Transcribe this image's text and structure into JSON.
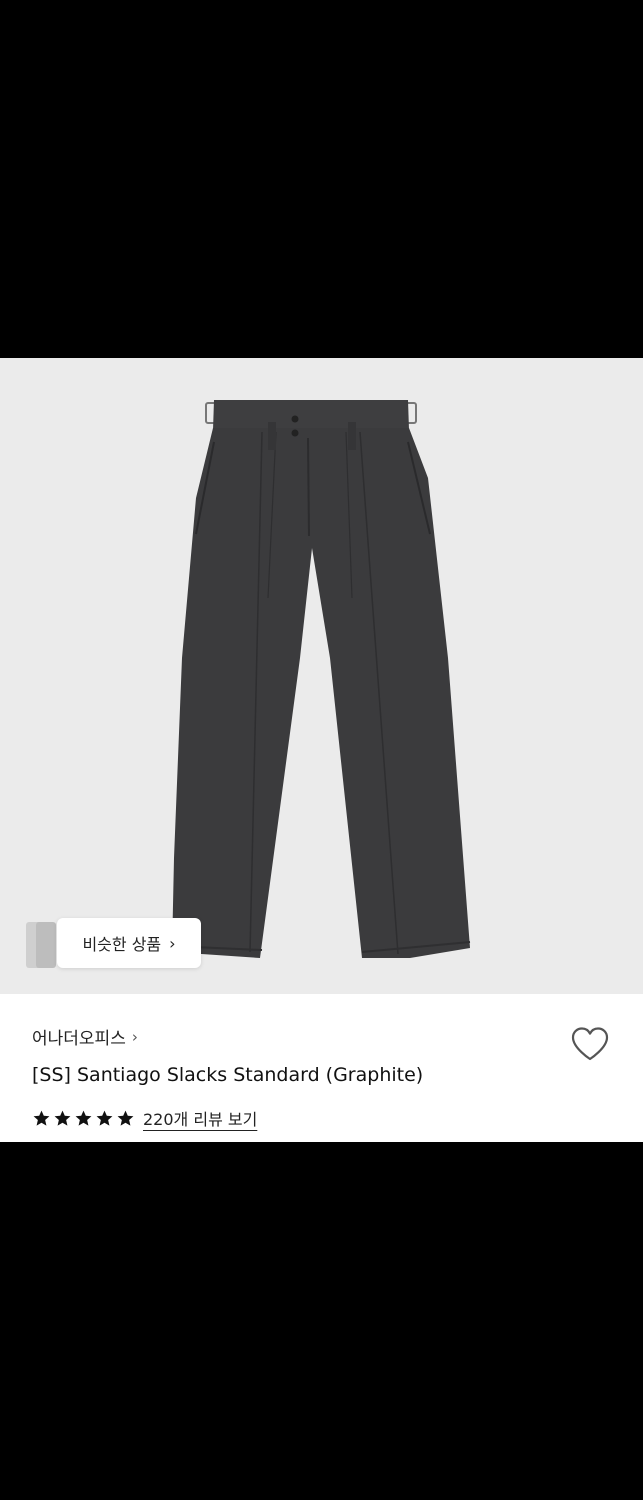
{
  "product": {
    "brand": "어나더오피스",
    "brand_chevron": "›",
    "title": "[SS] Santiago Slacks Standard (Graphite)",
    "rating_stars": 5,
    "reviews_label": "220개 리뷰 보기",
    "favorite_icon": "heart-outline-icon"
  },
  "image": {
    "similar_label": "비슷한 상품",
    "similar_chevron": "›",
    "background": "#ebebeb",
    "garment_color": "#3b3b3d"
  }
}
